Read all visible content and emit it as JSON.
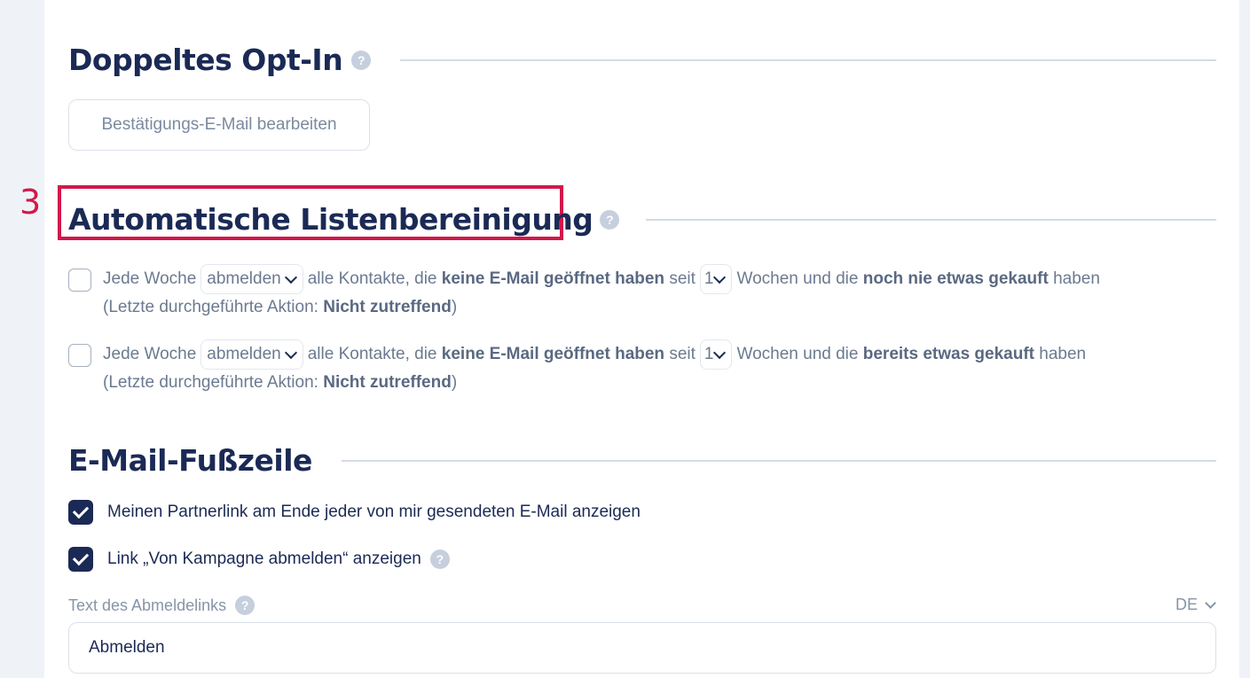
{
  "double_opt_in": {
    "title": "Doppeltes Opt-In",
    "help_icon": "?",
    "edit_button": "Bestätigungs-E-Mail bearbeiten"
  },
  "annotation": {
    "step_number": "3",
    "highlight_color": "#d2184b"
  },
  "auto_cleanup": {
    "title": "Automatische Listenbereinigung",
    "help_icon": "?",
    "rules": [
      {
        "checked": false,
        "prefix": "Jede Woche",
        "action": "abmelden",
        "t1": "alle Kontakte, die",
        "bold1": "keine E-Mail geöffnet haben",
        "t2": "seit",
        "weeks": "1",
        "t3": "Wochen und die",
        "bold2": "noch nie etwas gekauft",
        "t4": "haben",
        "last_action_prefix": "(Letzte durchgeführte Aktion:",
        "last_action_value": "Nicht zutreffend",
        "last_action_suffix": ")"
      },
      {
        "checked": false,
        "prefix": "Jede Woche",
        "action": "abmelden",
        "t1": "alle Kontakte, die",
        "bold1": "keine E-Mail geöffnet haben",
        "t2": "seit",
        "weeks": "1",
        "t3": "Wochen und die",
        "bold2": "bereits etwas gekauft",
        "t4": "haben",
        "last_action_prefix": "(Letzte durchgeführte Aktion:",
        "last_action_value": "Nicht zutreffend",
        "last_action_suffix": ")"
      }
    ]
  },
  "footer": {
    "title": "E-Mail-Fußzeile",
    "options": [
      {
        "checked": true,
        "label": "Meinen Partnerlink am Ende jeder von mir gesendeten E-Mail anzeigen"
      },
      {
        "checked": true,
        "label": "Link „Von Kampagne abmelden“ anzeigen"
      }
    ],
    "help_icon": "?",
    "unsubscribe_text_label": "Text des Abmeldelinks",
    "language": "DE",
    "unsubscribe_text_value": "Abmelden"
  },
  "colors": {
    "heading": "#1b2a55",
    "accent_checkbox": "#1b2a55",
    "muted_text": "#6b7a90",
    "background": "#eff3f8"
  }
}
